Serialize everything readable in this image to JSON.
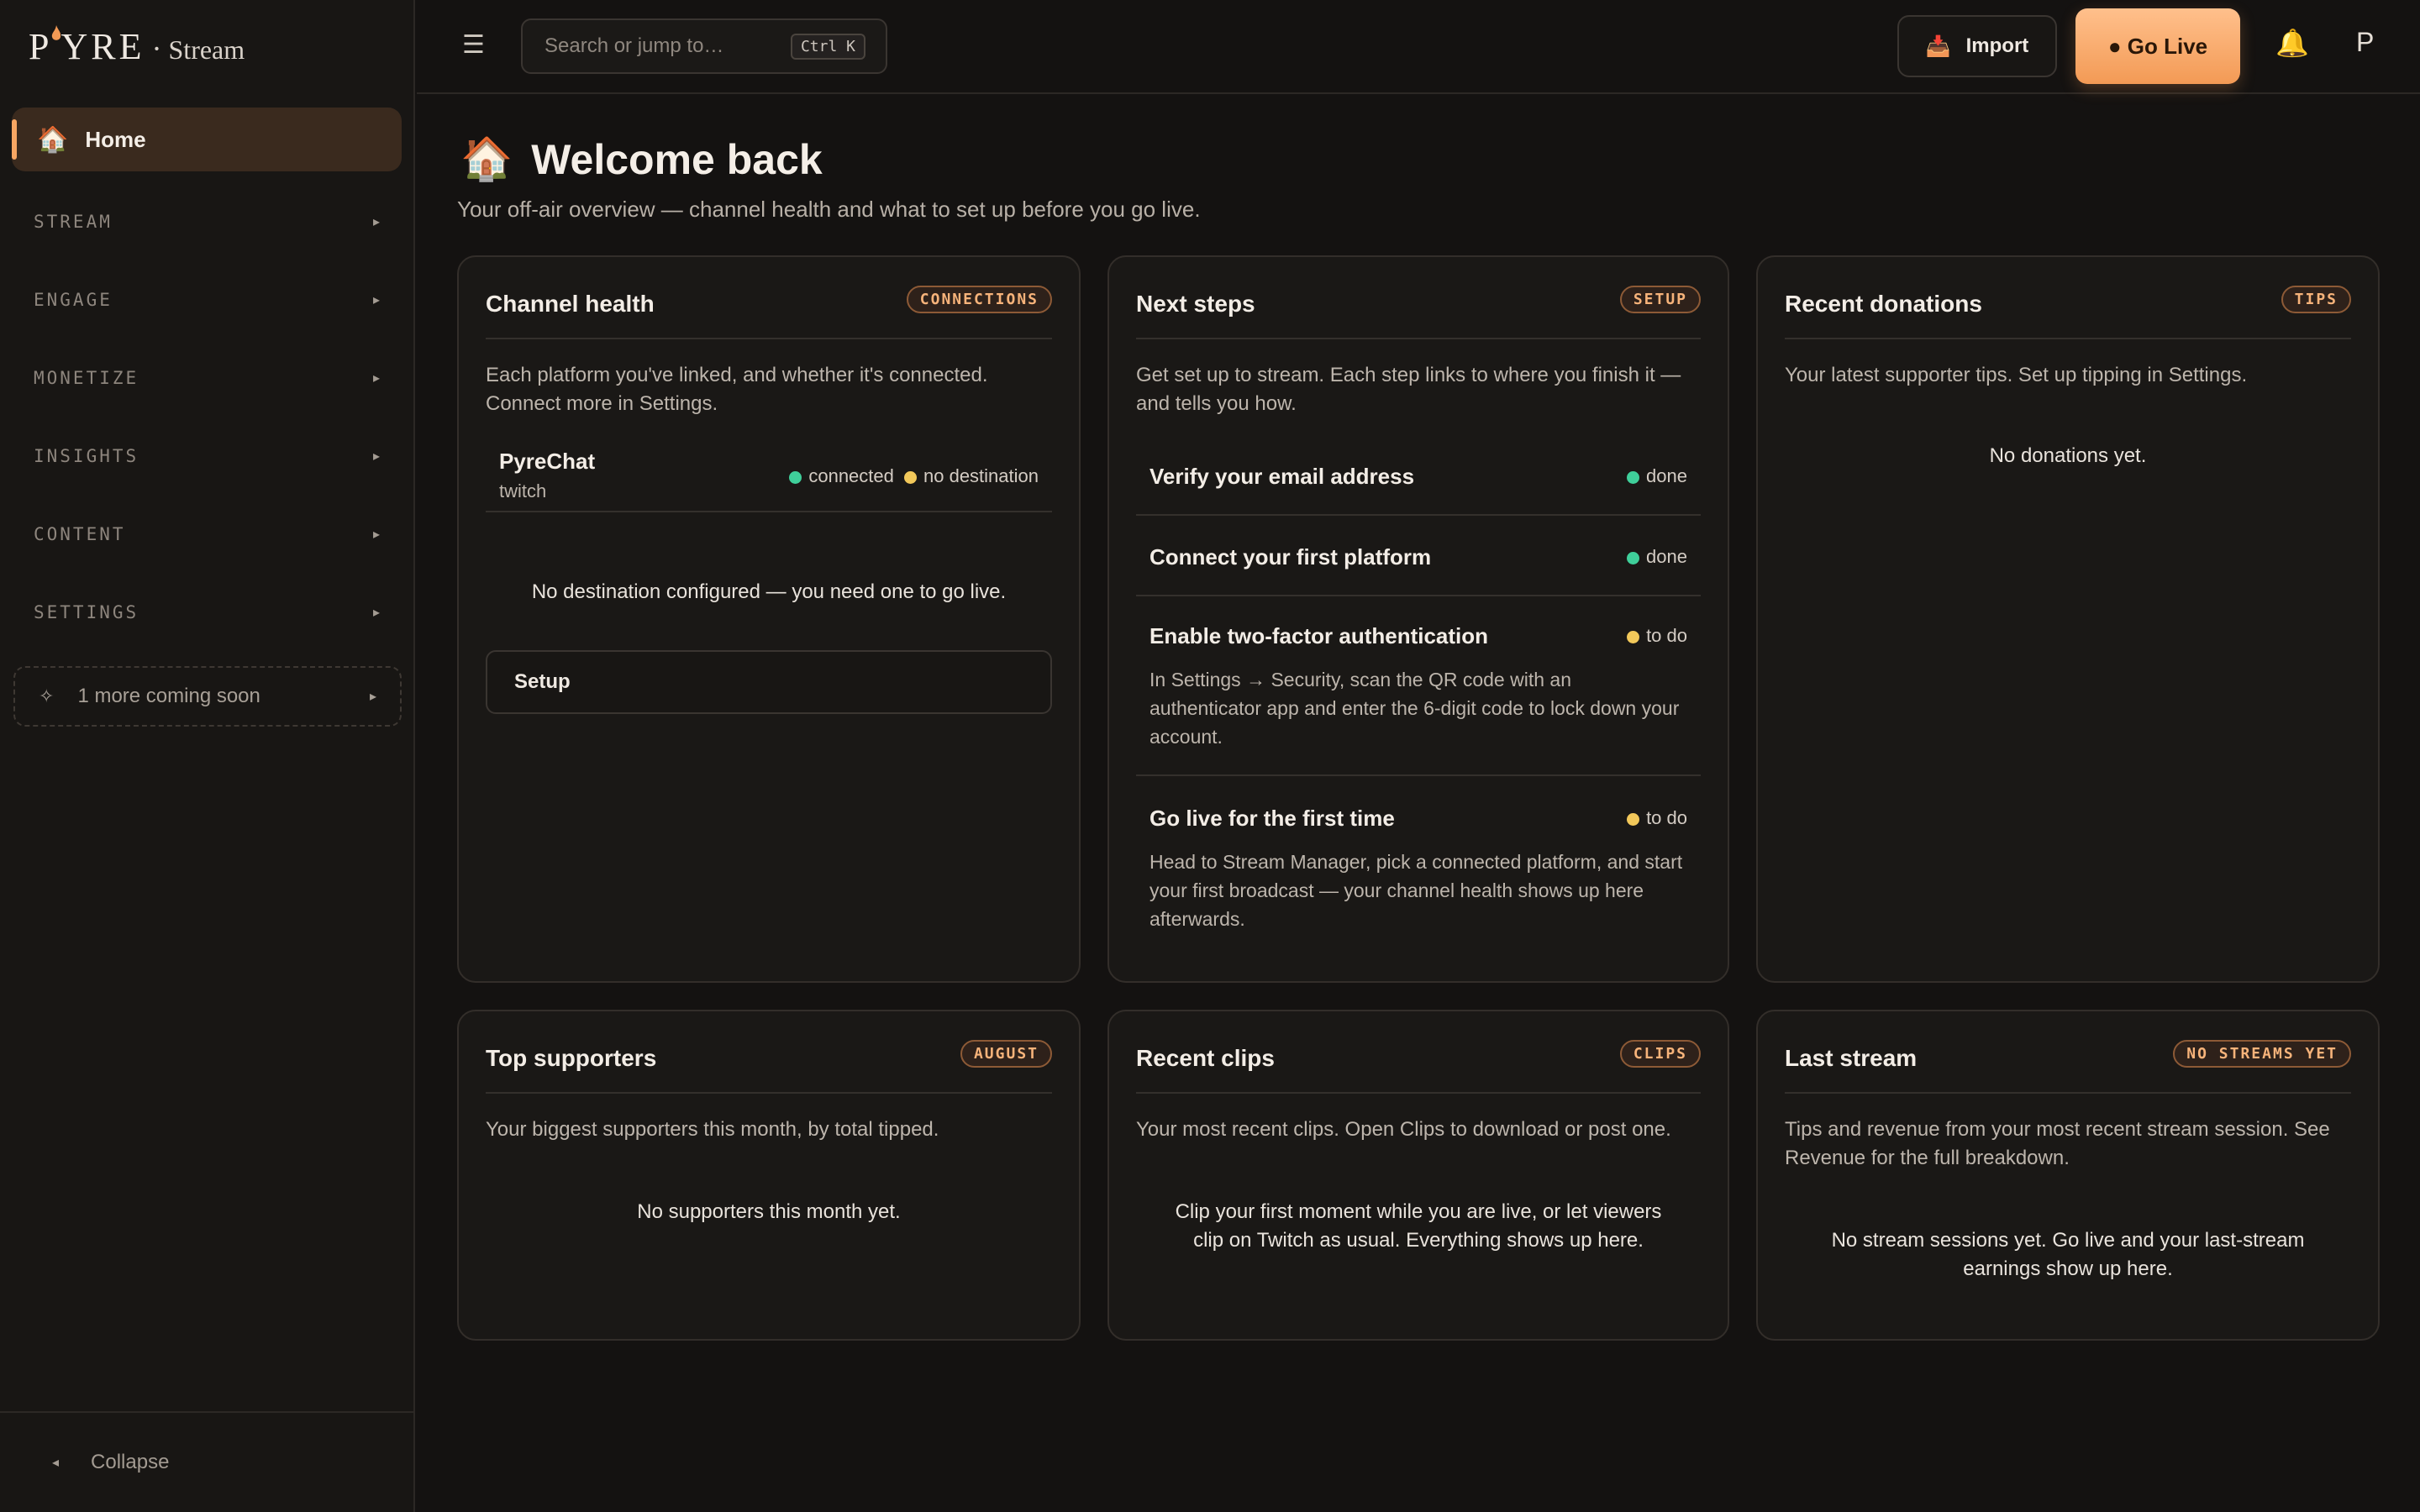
{
  "sidebar": {
    "logo": {
      "brand_left": "P",
      "brand_mid": "Y",
      "brand_right": "RE",
      "separator": "·",
      "product": "Stream"
    },
    "home": {
      "icon": "house-emoji",
      "label": "Home"
    },
    "sections": [
      {
        "label": "STREAM"
      },
      {
        "label": "ENGAGE"
      },
      {
        "label": "MONETIZE"
      },
      {
        "label": "INSIGHTS"
      },
      {
        "label": "CONTENT"
      },
      {
        "label": "SETTINGS"
      }
    ],
    "coming_soon": "1 more coming soon",
    "collapse": "Collapse"
  },
  "topbar": {
    "search_placeholder": "Search or jump to…",
    "shortcut": "Ctrl K",
    "import_label": "Import",
    "golive_label": "● Go Live",
    "avatar_initial": "P"
  },
  "page": {
    "title": "Welcome back",
    "subtitle": "Your off-air overview — channel health and what to set up before you go live."
  },
  "cards": {
    "channel_health": {
      "title": "Channel health",
      "badge": "CONNECTIONS",
      "desc": "Each platform you've linked, and whether it's connected. Connect more in Settings.",
      "platform": {
        "name": "PyreChat",
        "platform": "twitch",
        "status_connected": "connected",
        "status_destination": "no destination"
      },
      "message": "No destination configured — you need one to go live.",
      "setup_label": "Setup"
    },
    "next_steps": {
      "title": "Next steps",
      "badge": "SETUP",
      "desc": "Get set up to stream. Each step links to where you finish it — and tells you how.",
      "steps": [
        {
          "title": "Verify your email address",
          "status": "done",
          "desc": ""
        },
        {
          "title": "Connect your first platform",
          "status": "done",
          "desc": ""
        },
        {
          "title": "Enable two-factor authentication",
          "status": "to do",
          "desc": "In Settings → Security, scan the QR code with an authenticator app and enter the 6-digit code to lock down your account."
        },
        {
          "title": "Go live for the first time",
          "status": "to do",
          "desc": "Head to Stream Manager, pick a connected platform, and start your first broadcast — your channel health shows up here afterwards."
        }
      ]
    },
    "recent_donations": {
      "title": "Recent donations",
      "badge": "TIPS",
      "desc": "Your latest supporter tips. Set up tipping in Settings.",
      "message": "No donations yet."
    },
    "top_supporters": {
      "title": "Top supporters",
      "badge": "AUGUST",
      "desc": "Your biggest supporters this month, by total tipped.",
      "message": "No supporters this month yet."
    },
    "recent_clips": {
      "title": "Recent clips",
      "badge": "CLIPS",
      "desc": "Your most recent clips. Open Clips to download or post one.",
      "message": "Clip your first moment while you are live, or let viewers clip on Twitch as usual. Everything shows up here."
    },
    "last_stream": {
      "title": "Last stream",
      "badge": "NO STREAMS YET",
      "desc": "Tips and revenue from your most recent stream session. See Revenue for the full breakdown.",
      "message": "No stream sessions yet. Go live and your last-stream earnings show up here."
    }
  },
  "colors": {
    "accent": "#f7a663",
    "status_done": "#3fcf9a",
    "status_todo": "#f2c85a",
    "background": "#141211"
  }
}
